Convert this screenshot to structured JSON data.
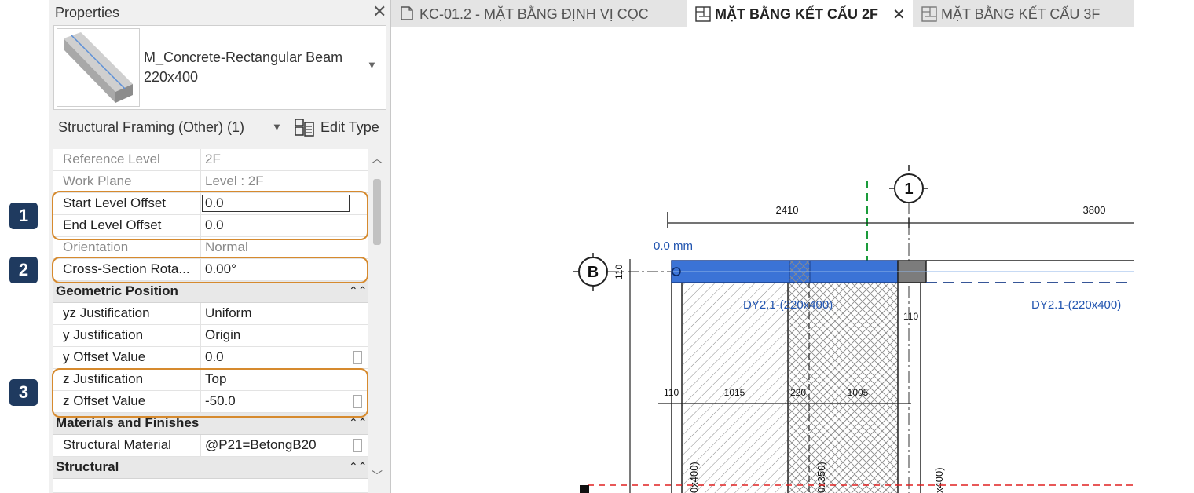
{
  "properties": {
    "title": "Properties",
    "type_name_line1": "M_Concrete-Rectangular Beam",
    "type_name_line2": "220x400",
    "category": "Structural Framing (Other) (1)",
    "edit_type": "Edit Type",
    "rows": {
      "reference_level": {
        "label": "Reference Level",
        "value": "2F"
      },
      "work_plane": {
        "label": "Work Plane",
        "value": "Level : 2F"
      },
      "start_level_offset": {
        "label": "Start Level Offset",
        "value": "0.0"
      },
      "end_level_offset": {
        "label": "End Level Offset",
        "value": "0.0"
      },
      "orientation": {
        "label": "Orientation",
        "value": "Normal"
      },
      "cross_section_rotation": {
        "label": "Cross-Section Rota...",
        "value": "0.00°"
      },
      "yz_justification": {
        "label": "yz Justification",
        "value": "Uniform"
      },
      "y_justification": {
        "label": "y Justification",
        "value": "Origin"
      },
      "y_offset_value": {
        "label": "y Offset Value",
        "value": "0.0"
      },
      "z_justification": {
        "label": "z Justification",
        "value": "Top"
      },
      "z_offset_value": {
        "label": "z Offset Value",
        "value": "-50.0"
      },
      "structural_material": {
        "label": "Structural Material",
        "value": "@P21=BetongB20"
      }
    },
    "groups": {
      "geometric_position": "Geometric Position",
      "materials_finishes": "Materials and Finishes",
      "structural": "Structural"
    }
  },
  "callouts": [
    "1",
    "2",
    "3"
  ],
  "tabs": [
    {
      "label": "KC-01.2 - MẶT BẰNG ĐỊNH VỊ CỌC"
    },
    {
      "label": "MẶT BẰNG KẾT CẤU 2F"
    },
    {
      "label": "MẶT BẰNG KẾT CẤU 3F"
    }
  ],
  "drawing": {
    "grid_1": "1",
    "grid_b": "B",
    "dim_2410": "2410",
    "dim_3800": "3800",
    "offset_label": "0.0 mm",
    "dim_110_vertical": "110",
    "beam_tag_1": "DY2.1-(220x400)",
    "beam_tag_2": "DY2.1-(220x400)",
    "dim_110_right": "110",
    "dim_110_left": "110",
    "dim_1015": "1015",
    "dim_220": "220",
    "dim_1005": "1005",
    "vert_tag_1": "0x400)",
    "vert_tag_2": "0x350)",
    "vert_tag_3": "x400)"
  },
  "colors": {
    "highlight": "#d68a2e",
    "badge": "#1f3a5f",
    "beam_fill": "#3b73d6",
    "grid_green": "#1a9b3a",
    "hidden_red": "#e02020",
    "tag_blue": "#2255b0"
  }
}
